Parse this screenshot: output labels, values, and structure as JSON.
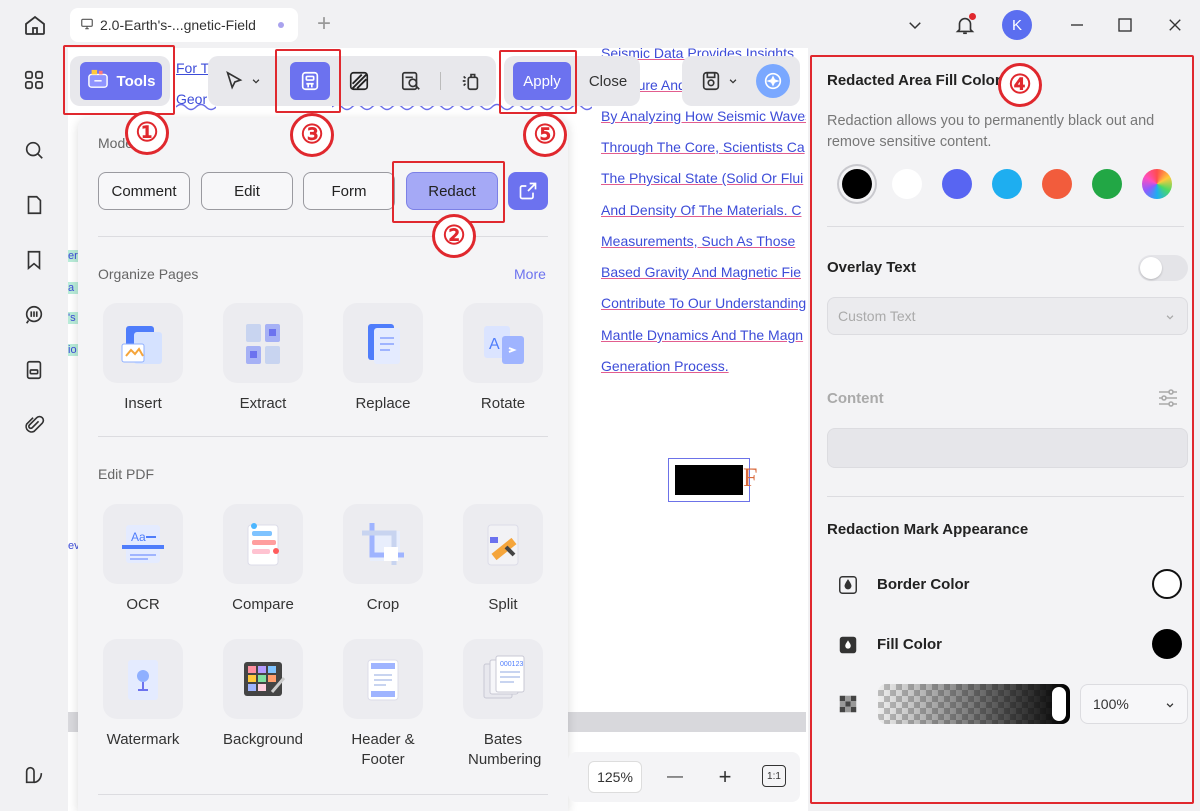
{
  "tab": {
    "title": "2.0-Earth's-...gnetic-Field"
  },
  "avatar": {
    "letter": "K"
  },
  "doc": {
    "left_fragments": [
      "For T",
      "Geor"
    ],
    "lines": [
      "Seismic Data Provides Insights",
      "Structure And",
      "By Analyzing How Seismic Waves",
      "Through The Core, Scientists Ca",
      "The Physical State (Solid Or Flui",
      "And Density Of The Materials. C",
      "Measurements, Such As Those",
      "Based Gravity And Magnetic Fie",
      "Contribute To Our Understanding",
      "Mantle Dynamics And The Magn",
      "Generation Process."
    ],
    "redact_letter": "F",
    "left_tags": [
      "er",
      "a",
      "'s",
      "io",
      "ev"
    ]
  },
  "toolbar": {
    "tools_label": "Tools",
    "apply_label": "Apply",
    "close_label": "Close"
  },
  "callouts": [
    "①",
    "②",
    "③",
    "④",
    "⑤"
  ],
  "tools": {
    "mode_label": "Mode",
    "modes": [
      "Comment",
      "Edit",
      "Form",
      "Redact"
    ],
    "organize": {
      "title": "Organize Pages",
      "more": "More",
      "items": [
        "Insert",
        "Extract",
        "Replace",
        "Rotate"
      ]
    },
    "edit": {
      "title": "Edit PDF",
      "items": [
        "OCR",
        "Compare",
        "Crop",
        "Split",
        "Watermark",
        "Background",
        "Header & Footer",
        "Bates Numbering"
      ]
    }
  },
  "zoom": {
    "value": "125%",
    "minus": "—",
    "plus": "+",
    "fit": "1:1"
  },
  "panel": {
    "fill_title": "Redacted Area Fill Color",
    "fill_desc": "Redaction allows you to permanently black out and remove sensitive content.",
    "colors": [
      "#000000",
      "#ffffff",
      "#5865f2",
      "#1eaef0",
      "#f25c3c",
      "#22a745",
      "rainbow"
    ],
    "overlay_title": "Overlay Text",
    "overlay_placeholder": "Custom Text",
    "content_title": "Content",
    "appearance_title": "Redaction Mark Appearance",
    "border_color": "Border Color",
    "fill_color": "Fill Color",
    "opacity": "100%"
  }
}
